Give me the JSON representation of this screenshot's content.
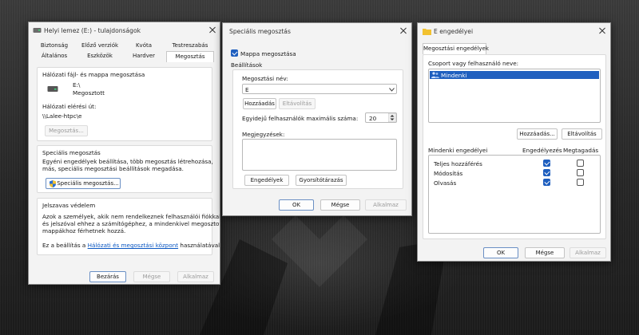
{
  "properties_window": {
    "title": "Helyi lemez (E:) - tulajdonságok",
    "tabs_row1": [
      "Biztonság",
      "Előző verziók",
      "Kvóta",
      "Testreszabás"
    ],
    "tabs_row2": [
      "Általános",
      "Eszközök",
      "Hardver",
      "Megosztás"
    ],
    "active_tab": "Megosztás",
    "network_section": {
      "header": "Hálózati fájl- és mappa megosztása",
      "drive_name": "E:\\",
      "drive_status": "Megosztott",
      "path_label": "Hálózati elérési út:",
      "path_value": "\\\\Lalee-htpc\\e",
      "share_button": "Megosztás..."
    },
    "advanced_section": {
      "header": "Speciális megosztás",
      "description": [
        "Egyéni engedélyek beállítása, több megosztás létrehozása,",
        "más, speciális megosztási beállítások megadása."
      ],
      "button": "Speciális megosztás..."
    },
    "password_section": {
      "header": "Jelszavas védelem",
      "description": [
        "Azok a személyek, akik nem rendelkeznek felhasználói fiókkal",
        "és jelszóval ehhez a számítógéphez, a mindenkivel megosztott",
        "mappákhoz férhetnek hozzá."
      ],
      "footer_pre": "Ez a beállítás a ",
      "footer_link": "Hálózati és megosztási központ",
      "footer_post": " használatával"
    },
    "buttons": {
      "close": "Bezárás",
      "cancel": "Mégse",
      "apply": "Alkalmaz"
    }
  },
  "advanced_window": {
    "title": "Speciális megosztás",
    "share_checkbox": {
      "label": "Mappa megosztása",
      "checked": true
    },
    "settings_label": "Beállítások",
    "share_name_label": "Megosztási név:",
    "share_name_value": "E",
    "add_button": "Hozzáadás",
    "remove_button": "Eltávolítás",
    "user_limit_label": "Egyidejű felhasználók maximális száma:",
    "user_limit_value": "20",
    "comments_label": "Megjegyzések:",
    "permissions_button": "Engedélyek",
    "caching_button": "Gyorsítótárazás",
    "buttons": {
      "ok": "OK",
      "cancel": "Mégse",
      "apply": "Alkalmaz"
    }
  },
  "permissions_window": {
    "title": "E engedélyei",
    "tab": "Megosztási engedélyek",
    "group_label": "Csoport vagy felhasználó neve:",
    "users": [
      "Mindenki"
    ],
    "add_button": "Hozzáadás...",
    "remove_button": "Eltávolítás",
    "perm_header": "Mindenki engedélyei",
    "allow_header": "Engedélyezés",
    "deny_header": "Megtagadás",
    "permissions": [
      {
        "name": "Teljes hozzáférés",
        "allow": true,
        "deny": false
      },
      {
        "name": "Módosítás",
        "allow": true,
        "deny": false
      },
      {
        "name": "Olvasás",
        "allow": true,
        "deny": false
      }
    ],
    "buttons": {
      "ok": "OK",
      "cancel": "Mégse",
      "apply": "Alkalmaz"
    }
  },
  "colors": {
    "accent": "#1f5fbf",
    "selection": "#1f5fbf",
    "link": "#0b57c2"
  }
}
